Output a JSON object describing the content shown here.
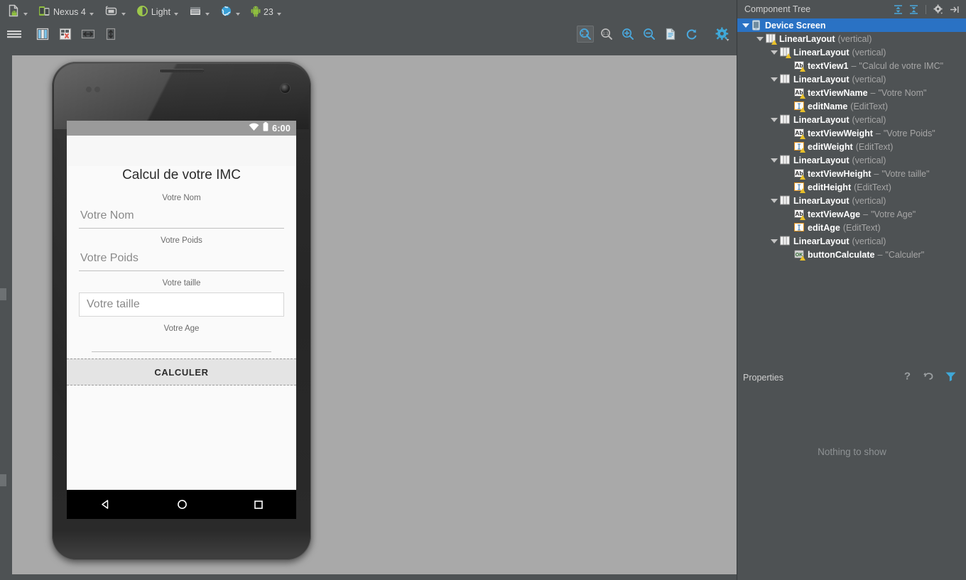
{
  "toolbar": {
    "items": [
      {
        "name": "layout-file-chooser",
        "icon": "android-file-icon",
        "label": "",
        "caret": true
      },
      {
        "name": "device-chooser",
        "icon": "device-icon",
        "label": "Nexus 4",
        "caret": true
      },
      {
        "name": "orientation-chooser",
        "icon": "orientation-icon",
        "label": "",
        "caret": true
      },
      {
        "name": "theme-chooser",
        "icon": "theme-contrast-icon",
        "label": "Light",
        "caret": true
      },
      {
        "name": "activity-chooser",
        "icon": "activity-window-icon",
        "label": "",
        "caret": true
      },
      {
        "name": "locale-chooser",
        "icon": "globe-icon",
        "label": "",
        "caret": true
      },
      {
        "name": "api-level-chooser",
        "icon": "android-robot-icon",
        "label": "23",
        "caret": true
      }
    ]
  },
  "toolbar2": {
    "items": [
      {
        "name": "menu-icon",
        "icon": "hamburger-icon"
      },
      {
        "name": "blueprint-toggle",
        "icon": "columns-icon"
      },
      {
        "name": "error-preview",
        "icon": "error-render-icon"
      },
      {
        "name": "fit-width",
        "icon": "arrows-horizontal-icon"
      },
      {
        "name": "fit-height",
        "icon": "arrows-vertical-icon"
      }
    ]
  },
  "zoomtools": {
    "items": [
      {
        "name": "zoom-to-fit",
        "icon": "zoom-fit-icon",
        "selected": true
      },
      {
        "name": "zoom-actual-size",
        "icon": "zoom-1to1-icon",
        "selected": false
      },
      {
        "name": "zoom-in",
        "icon": "zoom-in-icon",
        "selected": false
      },
      {
        "name": "zoom-out",
        "icon": "zoom-out-icon",
        "selected": false
      },
      {
        "name": "file-preview",
        "icon": "document-icon",
        "selected": false
      },
      {
        "name": "refresh",
        "icon": "refresh-icon",
        "selected": false
      },
      {
        "name": "settings",
        "icon": "gear-icon",
        "selected": false
      }
    ]
  },
  "preview": {
    "device_name": "Nexus 4",
    "statusbar": {
      "time": "6:00",
      "wifi_icon": "wifi-icon",
      "battery_icon": "battery-icon"
    },
    "app": {
      "title": "Calcul de votre IMC",
      "fields": [
        {
          "label": "Votre Nom",
          "value": "Votre Nom",
          "style": "underline"
        },
        {
          "label": "Votre Poids",
          "value": "Votre Poids",
          "style": "underline"
        },
        {
          "label": "Votre taille",
          "value": "Votre taille",
          "style": "box"
        },
        {
          "label": "Votre Age",
          "value": "",
          "style": "underline-empty"
        }
      ],
      "button_label": "CALCULER"
    },
    "navbar": {
      "back_icon": "triangle-back-icon",
      "home_icon": "circle-home-icon",
      "recents_icon": "square-recents-icon"
    }
  },
  "component_tree": {
    "title": "Component Tree",
    "header_icons": [
      {
        "name": "expand-all-icon"
      },
      {
        "name": "collapse-all-icon"
      },
      {
        "name": "tree-settings-icon"
      },
      {
        "name": "hide-panel-icon"
      }
    ],
    "nodes": [
      {
        "depth": 0,
        "twisty": "open",
        "icon": "device-screen-icon",
        "name": "Device Screen",
        "sub": "",
        "dash": "",
        "value": "",
        "warn": false,
        "selected": true
      },
      {
        "depth": 1,
        "twisty": "open",
        "icon": "linearlayout-icon",
        "name": "LinearLayout",
        "sub": "(vertical)",
        "dash": "",
        "value": "",
        "warn": true,
        "selected": false
      },
      {
        "depth": 2,
        "twisty": "open",
        "icon": "linearlayout-icon",
        "name": "LinearLayout",
        "sub": "(vertical)",
        "dash": "",
        "value": "",
        "warn": true,
        "selected": false
      },
      {
        "depth": 3,
        "twisty": "empty",
        "icon": "textview-icon",
        "name": "textView1",
        "sub": "",
        "dash": "–",
        "value": "\"Calcul de votre IMC\"",
        "warn": true,
        "selected": false
      },
      {
        "depth": 2,
        "twisty": "open",
        "icon": "linearlayout-icon",
        "name": "LinearLayout",
        "sub": "(vertical)",
        "dash": "",
        "value": "",
        "warn": false,
        "selected": false
      },
      {
        "depth": 3,
        "twisty": "empty",
        "icon": "textview-icon",
        "name": "textViewName",
        "sub": "",
        "dash": "–",
        "value": "\"Votre Nom\"",
        "warn": true,
        "selected": false
      },
      {
        "depth": 3,
        "twisty": "empty",
        "icon": "edittext-icon",
        "name": "editName",
        "sub": "(EditText)",
        "dash": "",
        "value": "",
        "warn": true,
        "selected": false
      },
      {
        "depth": 2,
        "twisty": "open",
        "icon": "linearlayout-icon",
        "name": "LinearLayout",
        "sub": "(vertical)",
        "dash": "",
        "value": "",
        "warn": false,
        "selected": false
      },
      {
        "depth": 3,
        "twisty": "empty",
        "icon": "textview-icon",
        "name": "textViewWeight",
        "sub": "",
        "dash": "–",
        "value": "\"Votre Poids\"",
        "warn": true,
        "selected": false
      },
      {
        "depth": 3,
        "twisty": "empty",
        "icon": "edittext-icon",
        "name": "editWeight",
        "sub": "(EditText)",
        "dash": "",
        "value": "",
        "warn": true,
        "selected": false
      },
      {
        "depth": 2,
        "twisty": "open",
        "icon": "linearlayout-icon",
        "name": "LinearLayout",
        "sub": "(vertical)",
        "dash": "",
        "value": "",
        "warn": false,
        "selected": false
      },
      {
        "depth": 3,
        "twisty": "empty",
        "icon": "textview-icon",
        "name": "textViewHeight",
        "sub": "",
        "dash": "–",
        "value": "\"Votre taille\"",
        "warn": true,
        "selected": false
      },
      {
        "depth": 3,
        "twisty": "empty",
        "icon": "edittext-icon",
        "name": "editHeight",
        "sub": "(EditText)",
        "dash": "",
        "value": "",
        "warn": true,
        "selected": false
      },
      {
        "depth": 2,
        "twisty": "open",
        "icon": "linearlayout-icon",
        "name": "LinearLayout",
        "sub": "(vertical)",
        "dash": "",
        "value": "",
        "warn": false,
        "selected": false
      },
      {
        "depth": 3,
        "twisty": "empty",
        "icon": "textview-icon",
        "name": "textViewAge",
        "sub": "",
        "dash": "–",
        "value": "\"Votre Age\"",
        "warn": true,
        "selected": false
      },
      {
        "depth": 3,
        "twisty": "empty",
        "icon": "edittext-icon",
        "name": "editAge",
        "sub": "(EditText)",
        "dash": "",
        "value": "",
        "warn": false,
        "selected": false
      },
      {
        "depth": 2,
        "twisty": "open",
        "icon": "linearlayout-icon",
        "name": "LinearLayout",
        "sub": "(vertical)",
        "dash": "",
        "value": "",
        "warn": false,
        "selected": false
      },
      {
        "depth": 3,
        "twisty": "empty",
        "icon": "button-icon",
        "name": "buttonCalculate",
        "sub": "",
        "dash": "–",
        "value": "\"Calculer\"",
        "warn": true,
        "selected": false
      }
    ]
  },
  "properties": {
    "title": "Properties",
    "empty_message": "Nothing to show",
    "icons": [
      {
        "name": "help-icon"
      },
      {
        "name": "restore-default-icon"
      },
      {
        "name": "filter-icon"
      }
    ]
  },
  "colors": {
    "panel_bg": "#4e5254",
    "canvas_bg": "#a9a9a9",
    "selection_blue": "#2a72c4",
    "accent_cyan": "#389fd6",
    "warning_yellow": "#e8c02a"
  }
}
